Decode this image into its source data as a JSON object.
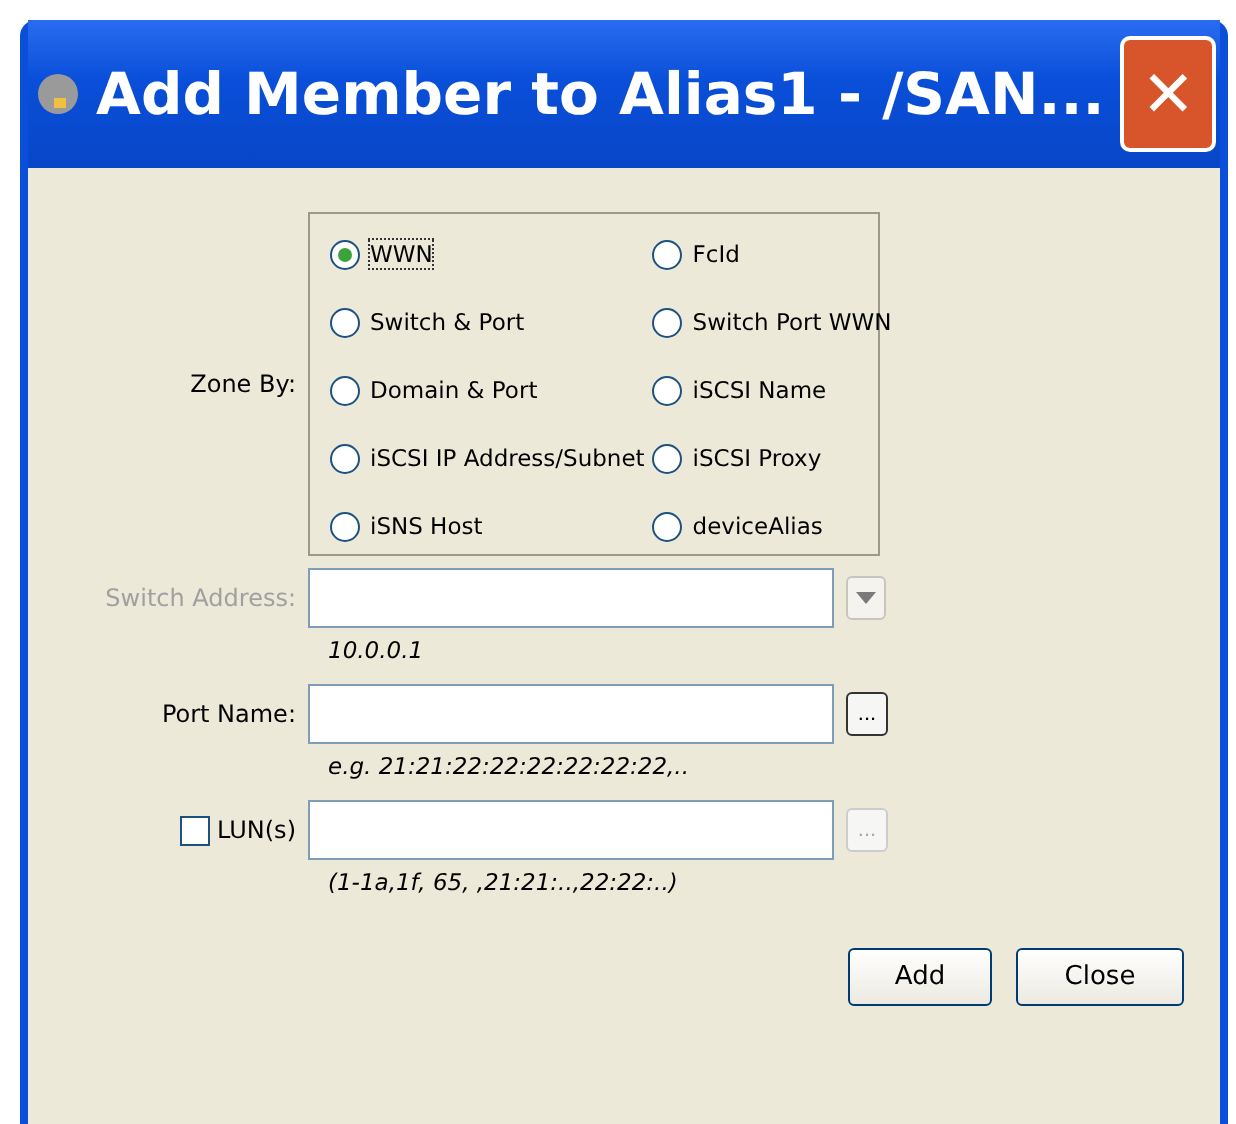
{
  "window": {
    "title": "Add Member to Alias1 - /SAN...",
    "close": "✕"
  },
  "zone_by": {
    "label": "Zone By:",
    "options": [
      {
        "label": "WWN",
        "selected": true
      },
      {
        "label": "FcId",
        "selected": false
      },
      {
        "label": "Switch & Port",
        "selected": false
      },
      {
        "label": "Switch Port WWN",
        "selected": false
      },
      {
        "label": "Domain & Port",
        "selected": false
      },
      {
        "label": "iSCSI Name",
        "selected": false
      },
      {
        "label": "iSCSI IP Address/Subnet",
        "selected": false
      },
      {
        "label": "iSCSI Proxy",
        "selected": false
      },
      {
        "label": "iSNS Host",
        "selected": false
      },
      {
        "label": "deviceAlias",
        "selected": false
      }
    ]
  },
  "fields": [
    {
      "kind": "dropdown",
      "label": "Switch Address:",
      "disabled": true,
      "hint": "10.0.0.1"
    },
    {
      "kind": "browse",
      "label": "Port Name:",
      "button": "...",
      "hint": "e.g. 21:21:22:22:22:22:22:22,.."
    },
    {
      "kind": "checkbox-browse",
      "label": "LUN(s)",
      "checked": false,
      "disabled": true,
      "button": "...",
      "hint": "(1-1a,1f, 65, ,21:21:..,22:22:..)"
    }
  ],
  "buttons": [
    "Add",
    "Close"
  ]
}
